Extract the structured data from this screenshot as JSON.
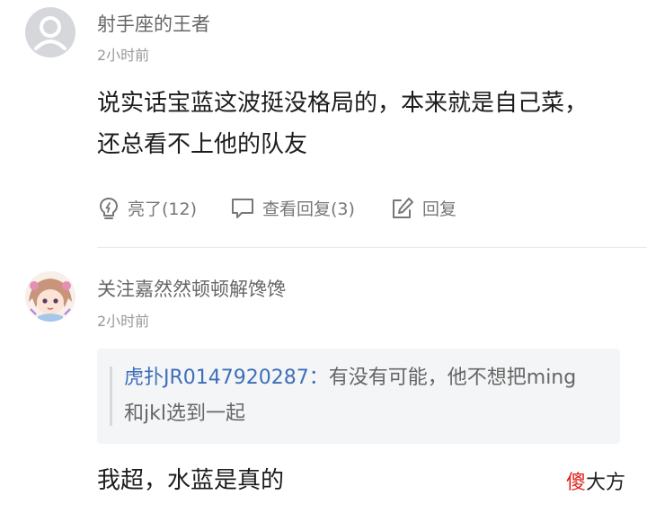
{
  "comment1": {
    "username": "射手座的王者",
    "time": "2小时前",
    "content_line1": "说实话宝蓝这波挺没格局的，本来就是自己菜，",
    "content_line2": "还总看不上他的队友",
    "actions": {
      "like_label": "亮了(12)",
      "view_replies_label": "查看回复(3)",
      "reply_label": "回复"
    }
  },
  "comment2": {
    "username": "关注嘉然然顿顿解馋馋",
    "time": "2小时前",
    "quote": {
      "author": "虎扑JR0147920287",
      "separator": "：",
      "text_line1": "有没有可能，他不想把ming",
      "text_line2": "和jkl选到一起"
    },
    "content": "我超，水蓝是真的"
  },
  "watermark": {
    "char1": "傻",
    "rest": "大方",
    "accent_color": "#e0201c"
  },
  "icons": [
    "default-avatar-icon",
    "lightbulb-icon",
    "comment-icon",
    "edit-reply-icon",
    "anime-avatar"
  ]
}
